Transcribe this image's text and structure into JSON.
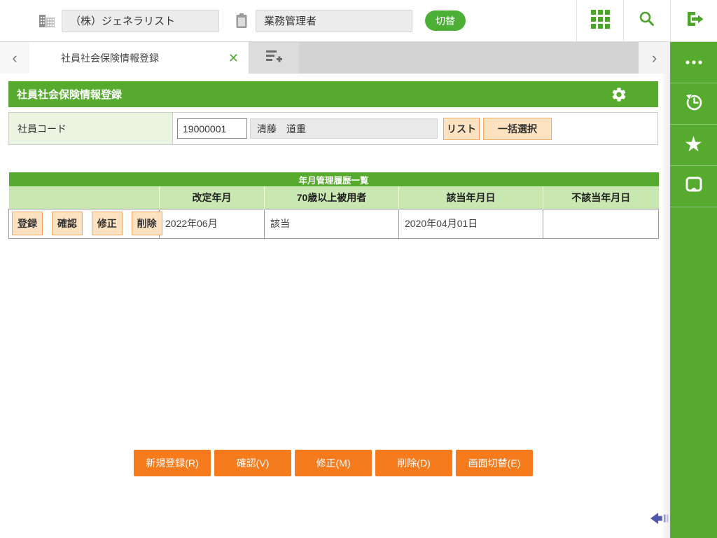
{
  "header": {
    "company_name": "（株）ジェネラリスト",
    "role_name": "業務管理者",
    "switch_button": "切替"
  },
  "tab_bar": {
    "scroll_left_glyph": "‹",
    "scroll_right_glyph": "›",
    "active_tab": "社員社会保険情報登録",
    "close_glyph": "✕"
  },
  "page": {
    "title": "社員社会保険情報登録"
  },
  "employee_form": {
    "code_label": "社員コード",
    "code_value": "19000001",
    "name_value": "清藤　道重",
    "list_button": "リスト",
    "bulk_select_button": "一括選択"
  },
  "history_table": {
    "title": "年月管理履歴一覧",
    "columns": [
      "改定年月",
      "70歳以上被用者",
      "該当年月日",
      "不該当年月日"
    ],
    "row_buttons": [
      "登録",
      "確認",
      "修正",
      "削除"
    ],
    "rows": [
      {
        "revision_month": "2022年06月",
        "over_70_insured": "該当",
        "applicable_date": "2020年04月01日",
        "not_applicable_date": ""
      }
    ]
  },
  "action_bar": {
    "buttons": [
      "新規登録(R)",
      "確認(V)",
      "修正(M)",
      "削除(D)",
      "画面切替(E)"
    ]
  },
  "colors": {
    "primary_green": "#56ab2e",
    "table_header_green": "#c9e7b0",
    "label_cell_green": "#eaf5e1",
    "peach_button_bg": "#fde2c1",
    "peach_button_border": "#f2aa66",
    "orange_button": "#f57b1d",
    "collapse_arrow_blue": "#4d57a5"
  }
}
